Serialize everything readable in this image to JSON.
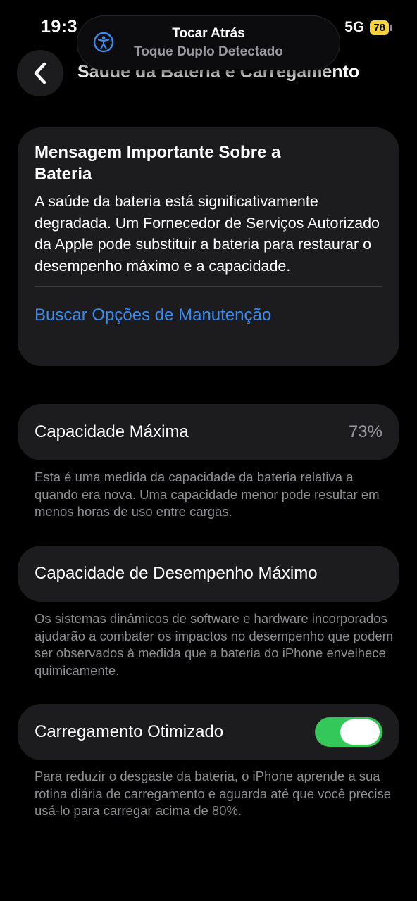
{
  "status_bar": {
    "time": "19:3",
    "network": "5G",
    "battery_level": "78",
    "battery_color": "#f7d23b"
  },
  "toast": {
    "icon": "accessibility-icon",
    "title": "Tocar Atrás",
    "subtitle": "Toque Duplo Detectado"
  },
  "header": {
    "back_icon": "chevron-left-icon",
    "title": "Saúde da Bateria e Carregamento"
  },
  "message_card": {
    "title": "Mensagem Importante Sobre a Bateria",
    "body": "A saúde da bateria está significativamente degradada. Um Fornecedor de Serviços Autorizado da Apple pode substituir a bateria para restaurar o desempenho máximo e a capacidade.",
    "link": "Buscar Opções de Manutenção",
    "link_color": "#3b8cf0"
  },
  "max_capacity": {
    "label": "Capacidade Máxima",
    "value": "73%",
    "footnote": "Esta é uma medida da capacidade da bateria relativa a quando era nova. Uma capacidade menor pode resultar em menos horas de uso entre cargas."
  },
  "peak_performance": {
    "label": "Capacidade de Desempenho Máximo",
    "footnote": "Os sistemas dinâmicos de software e hardware incorporados ajudarão a combater os impactos no desempenho que podem ser observados à medida que a bateria do iPhone envelhece quimicamente."
  },
  "optimized_charging": {
    "label": "Carregamento Otimizado",
    "enabled": true,
    "toggle_color": "#34c759",
    "footnote": "Para reduzir o desgaste da bateria, o iPhone aprende a sua rotina diária de carregamento e aguarda até que você precise usá-lo para carregar acima de 80%."
  }
}
